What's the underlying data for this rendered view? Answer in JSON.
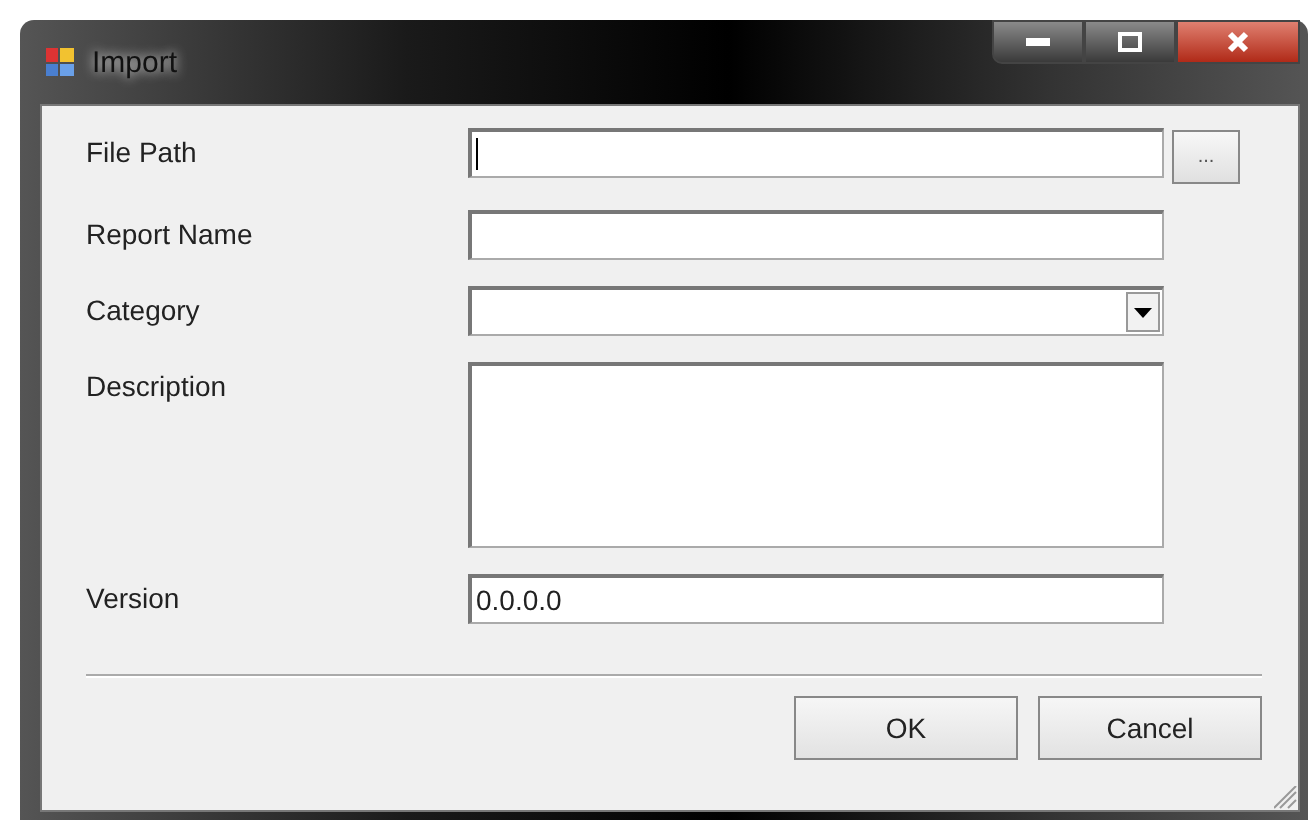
{
  "window": {
    "title": "Import"
  },
  "fields": [
    {
      "label": "File Path",
      "kind": "browse",
      "button": "..."
    },
    {
      "label": "Report Name",
      "kind": "text"
    },
    {
      "label": "Category",
      "kind": "dropdown"
    },
    {
      "label": "Description",
      "kind": "multiline"
    },
    {
      "label": "Version",
      "kind": "text",
      "value": "0.0.0.0"
    }
  ],
  "buttons": [
    "OK",
    "Cancel"
  ]
}
